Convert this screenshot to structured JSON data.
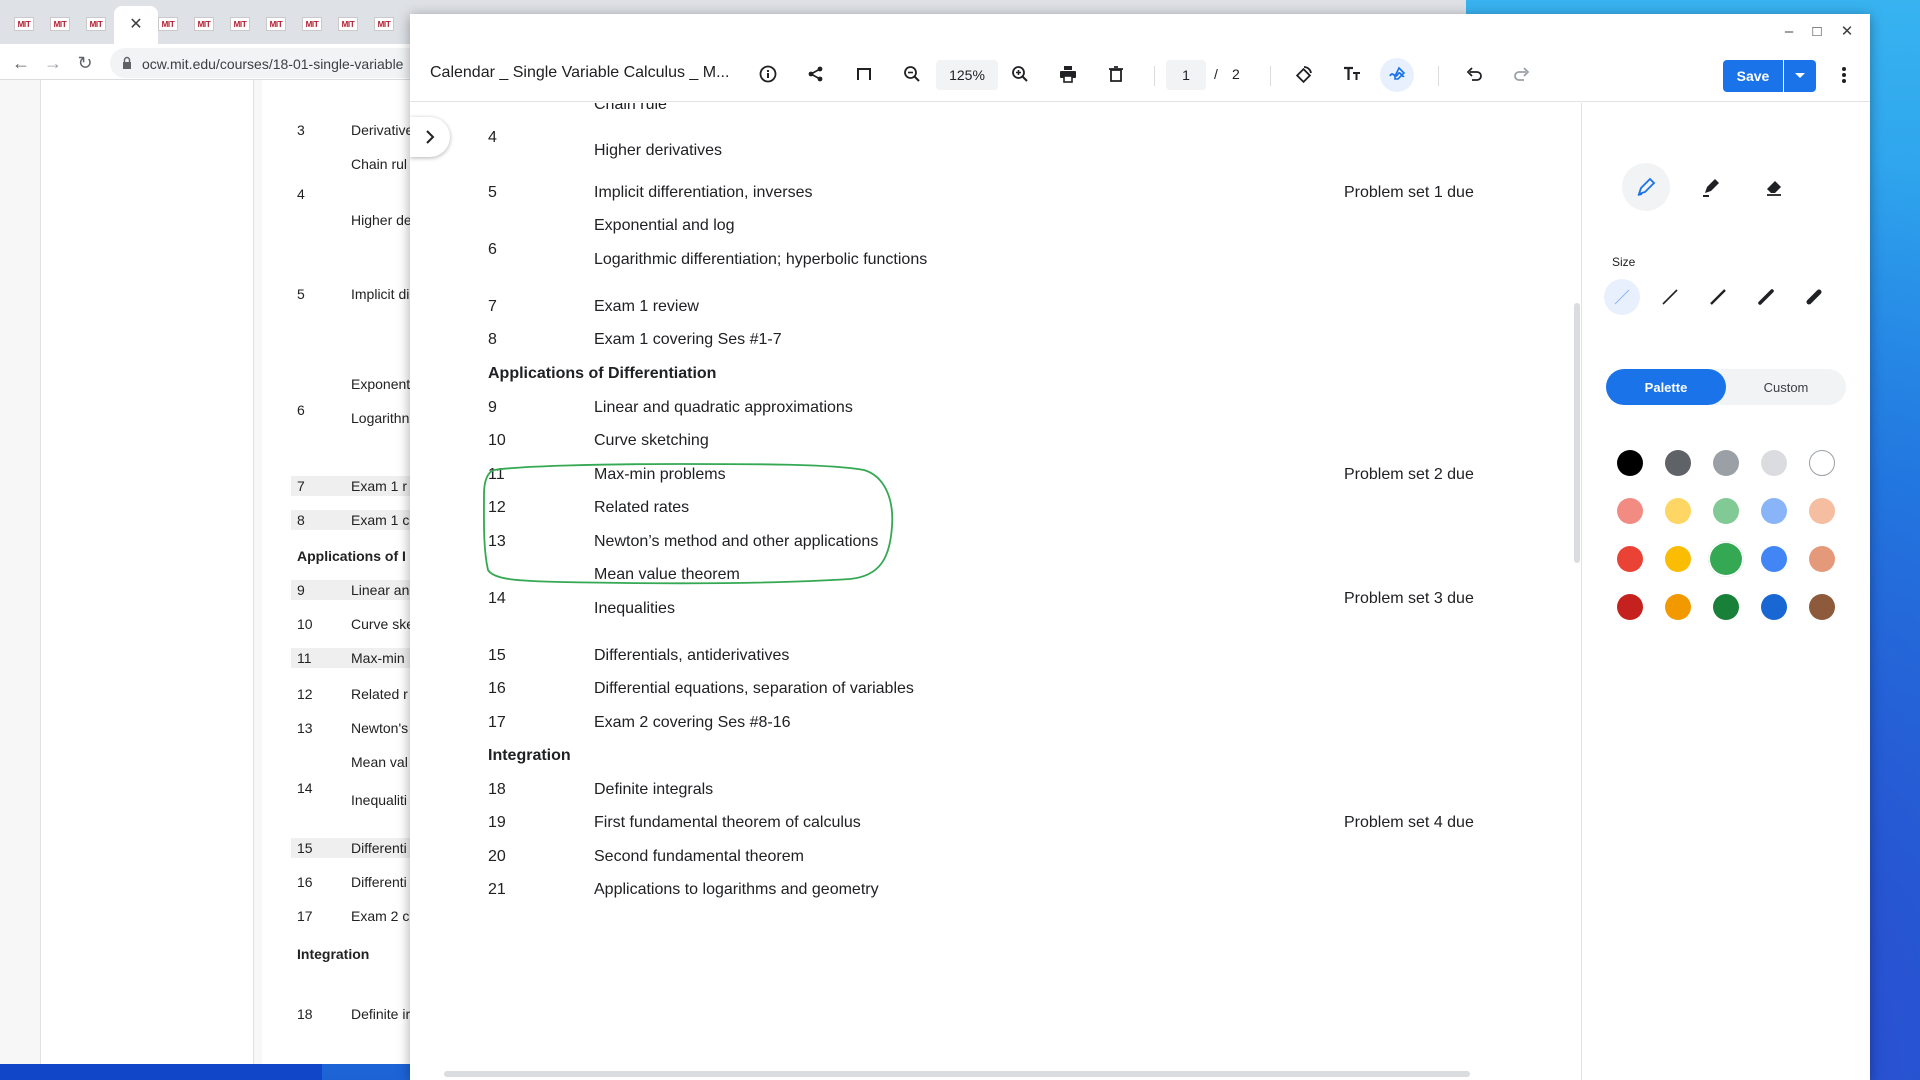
{
  "browser": {
    "tab_favicon_text": "MIT\nOCW",
    "active_tab_close": "✕",
    "url": "ocw.mit.edu/courses/18-01-single-variable",
    "rows": [
      {
        "num": "3",
        "title": "Derivative"
      },
      {
        "num": "",
        "title": "Chain rul"
      },
      {
        "num": "4",
        "title": ""
      },
      {
        "num": "",
        "title": "Higher de"
      },
      {
        "num": "5",
        "title": "Implicit di"
      },
      {
        "num": "",
        "title": "Exponent"
      },
      {
        "num": "6",
        "title": ""
      },
      {
        "num": "",
        "title": "Logarithn"
      },
      {
        "num": "7",
        "title": "Exam 1 r"
      },
      {
        "num": "8",
        "title": "Exam 1 c"
      },
      {
        "num": "9",
        "title": "Linear an"
      },
      {
        "num": "10",
        "title": "Curve ske"
      },
      {
        "num": "11",
        "title": "Max-min"
      },
      {
        "num": "12",
        "title": "Related r"
      },
      {
        "num": "13",
        "title": "Newton's"
      },
      {
        "num": "",
        "title": "Mean val"
      },
      {
        "num": "14",
        "title": ""
      },
      {
        "num": "",
        "title": "Inequaliti"
      },
      {
        "num": "15",
        "title": "Differenti"
      },
      {
        "num": "16",
        "title": "Differenti"
      },
      {
        "num": "17",
        "title": "Exam 2 c"
      },
      {
        "num": "18",
        "title": "Definite ir"
      }
    ],
    "sections": [
      "Applications of I",
      "Integration"
    ]
  },
  "window": {
    "minimize": "–",
    "maximize": "□",
    "close": "✕"
  },
  "toolbar": {
    "doc_title": "Calendar _ Single Variable Calculus _ M...",
    "zoom": "125%",
    "page_current": "1",
    "page_sep": "/",
    "page_total": "2",
    "save_label": "Save"
  },
  "doc": {
    "rows": [
      {
        "num": "",
        "title": "Chain rule",
        "due": ""
      },
      {
        "num": "4",
        "title": "",
        "due": ""
      },
      {
        "num": "",
        "title": "Higher derivatives",
        "due": ""
      },
      {
        "num": "5",
        "title": "Implicit differentiation, inverses",
        "due": "Problem set 1 due"
      },
      {
        "num": "",
        "title": "Exponential and log",
        "due": ""
      },
      {
        "num": "6",
        "title": "",
        "due": ""
      },
      {
        "num": "",
        "title": "Logarithmic differentiation; hyperbolic functions",
        "due": ""
      },
      {
        "num": "7",
        "title": "Exam 1 review",
        "due": ""
      },
      {
        "num": "8",
        "title": "Exam 1 covering Ses #1-7",
        "due": ""
      },
      {
        "num": "9",
        "title": "Linear and quadratic approximations",
        "due": ""
      },
      {
        "num": "10",
        "title": "Curve sketching",
        "due": ""
      },
      {
        "num": "11",
        "title": "Max-min problems",
        "due": "Problem set 2 due"
      },
      {
        "num": "12",
        "title": "Related rates",
        "due": ""
      },
      {
        "num": "13",
        "title": "Newton’s method and other applications",
        "due": ""
      },
      {
        "num": "",
        "title": "Mean value theorem",
        "due": ""
      },
      {
        "num": "14",
        "title": "",
        "due": "Problem set 3 due"
      },
      {
        "num": "",
        "title": "Inequalities",
        "due": ""
      },
      {
        "num": "15",
        "title": "Differentials, antiderivatives",
        "due": ""
      },
      {
        "num": "16",
        "title": "Differential equations, separation of variables",
        "due": ""
      },
      {
        "num": "17",
        "title": "Exam 2 covering Ses #8-16",
        "due": ""
      },
      {
        "num": "18",
        "title": "Definite integrals",
        "due": ""
      },
      {
        "num": "19",
        "title": "First fundamental theorem of calculus",
        "due": "Problem set 4 due"
      },
      {
        "num": "20",
        "title": "Second fundamental theorem",
        "due": ""
      },
      {
        "num": "21",
        "title": "Applications to logarithms and geometry",
        "due": ""
      }
    ],
    "sections": [
      "Applications of Differentiation",
      "Integration"
    ],
    "ink_color": "#34a853"
  },
  "annot_panel": {
    "size_label": "Size",
    "palette_label": "Palette",
    "custom_label": "Custom",
    "selected_color": "#34a853",
    "colors": [
      "#000000",
      "#5f6368",
      "#9aa0a6",
      "#dadce0",
      "#ffffff",
      "#f28b82",
      "#fdd663",
      "#81c995",
      "#8ab4f8",
      "#f6bea0",
      "#ea4335",
      "#fbbc04",
      "#34a853",
      "#4285f4",
      "#e49a7a",
      "#c5221f",
      "#f29900",
      "#188038",
      "#1967d2",
      "#8d5a3b"
    ]
  }
}
